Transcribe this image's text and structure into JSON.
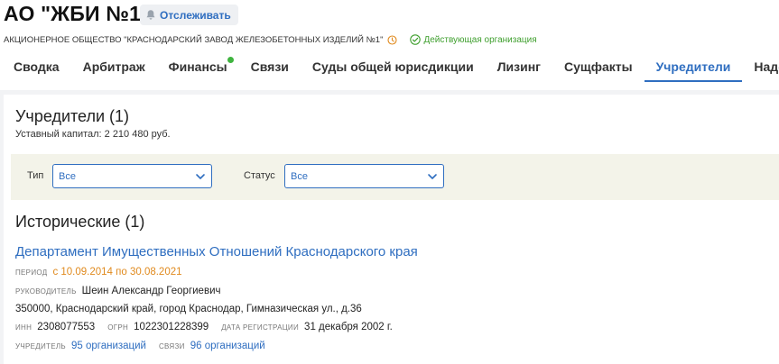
{
  "header": {
    "title": "АО \"ЖБИ №1\"",
    "follow_label": "Отслеживать",
    "full_name": "АКЦИОНЕРНОЕ ОБЩЕСТВО \"КРАСНОДАРСКИЙ ЗАВОД ЖЕЛЕЗОБЕТОННЫХ ИЗДЕЛИЙ №1\"",
    "status": "Действующая организация"
  },
  "tabs": [
    {
      "label": "Сводка"
    },
    {
      "label": "Арбитраж"
    },
    {
      "label": "Финансы"
    },
    {
      "label": "Связи"
    },
    {
      "label": "Суды общей юрисдикции"
    },
    {
      "label": "Лизинг"
    },
    {
      "label": "Сущфакты"
    },
    {
      "label": "Учредители"
    },
    {
      "label": "Надежность"
    }
  ],
  "founders": {
    "title": "Учредители (1)",
    "capital": "Уставный капитал: 2 210 480 руб.",
    "filters": {
      "type_label": "Тип",
      "type_value": "Все",
      "status_label": "Статус",
      "status_value": "Все"
    },
    "historical_title": "Исторические (1)",
    "entry": {
      "name": "Департамент Имущественных Отношений Краснодарского края",
      "period_label": "ПЕРИОД",
      "period_value": "с 10.09.2014 по 30.08.2021",
      "head_label": "РУКОВОДИТЕЛЬ",
      "head_value": "Шеин Александр Георгиевич",
      "address": "350000, Краснодарский край, город Краснодар, Гимназическая ул., д.36",
      "inn_label": "ИНН",
      "inn_value": "2308077553",
      "ogrn_label": "ОГРН",
      "ogrn_value": "1022301228399",
      "reg_label": "ДАТА РЕГИСТРАЦИИ",
      "reg_value": "31 декабря 2002 г.",
      "founder_label": "УЧРЕДИТЕЛЬ",
      "founder_value": "95 организаций",
      "links_label": "СВЯЗИ",
      "links_value": "96 организаций"
    }
  },
  "colors": {
    "accent": "#2f6ec0",
    "status_green": "#3f9f2e",
    "period_orange": "#e08a1e",
    "filter_bg": "#f3f3e9"
  },
  "icons": [
    "bell-icon",
    "clock-icon",
    "check-circle-icon",
    "chevron-down-icon"
  ]
}
